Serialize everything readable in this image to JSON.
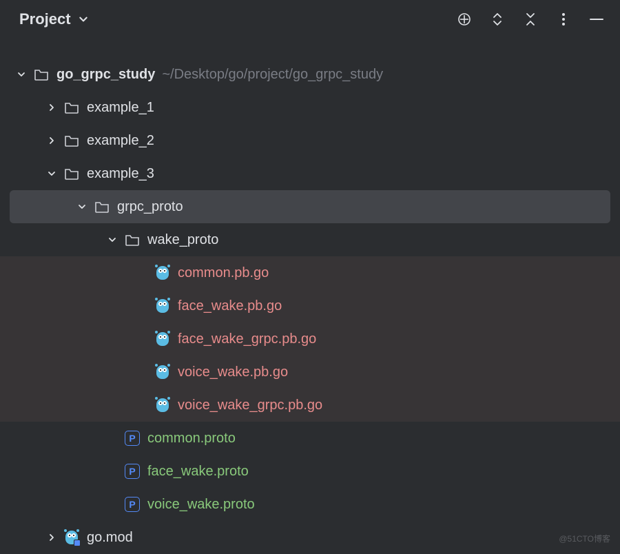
{
  "header": {
    "title": "Project"
  },
  "tree": {
    "root": {
      "name": "go_grpc_study",
      "path": "~/Desktop/go/project/go_grpc_study"
    },
    "example1": "example_1",
    "example2": "example_2",
    "example3": "example_3",
    "grpc_proto": "grpc_proto",
    "wake_proto": "wake_proto",
    "files": {
      "f0": "common.pb.go",
      "f1": "face_wake.pb.go",
      "f2": "face_wake_grpc.pb.go",
      "f3": "voice_wake.pb.go",
      "f4": "voice_wake_grpc.pb.go"
    },
    "protos": {
      "p0": "common.proto",
      "p1": "face_wake.proto",
      "p2": "voice_wake.proto"
    },
    "gomod": "go.mod"
  },
  "proto_badge_letter": "P",
  "watermark": "@51CTO博客"
}
